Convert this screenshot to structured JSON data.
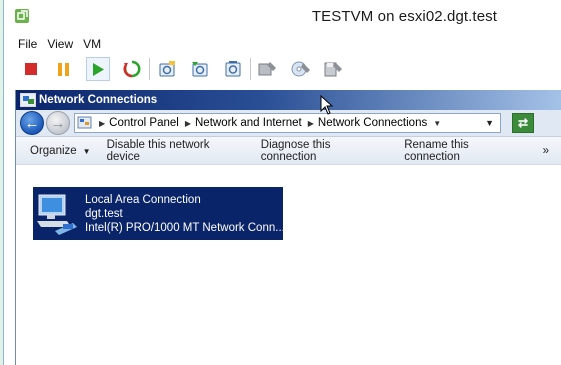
{
  "vm": {
    "title": "TESTVM on esxi02.dgt.test",
    "menu": [
      "File",
      "View",
      "VM"
    ],
    "toolbar_icons": [
      "stop-icon",
      "pause-icon",
      "play-icon",
      "reset-icon",
      "snapshot-icon",
      "revert-snapshot-icon",
      "snapshot-manager-icon",
      "vm-settings-icon",
      "connect-cd-icon",
      "connect-floppy-icon"
    ]
  },
  "guest": {
    "title": "Network Connections",
    "breadcrumbs": [
      "Control Panel",
      "Network and Internet",
      "Network Connections"
    ],
    "commands": {
      "organize": "Organize",
      "disable": "Disable this network device",
      "diagnose": "Diagnose this connection",
      "rename": "Rename this connection",
      "more": "»"
    },
    "adapter": {
      "name": "Local Area Connection",
      "network": "dgt.test",
      "device": "Intel(R) PRO/1000 MT Network Conn..."
    }
  },
  "colors": {
    "selection": "#0a246a",
    "title_gradient_start": "#0a246a",
    "stop": "#d42b2b",
    "pause": "#f0a21a",
    "play": "#2aa52a"
  }
}
